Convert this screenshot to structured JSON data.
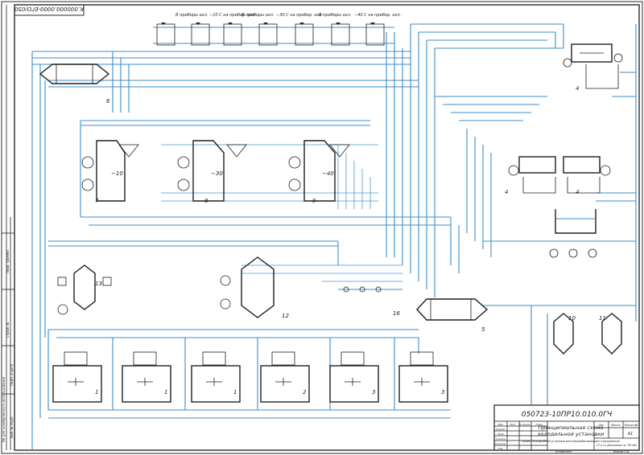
{
  "stamp_top": "К.000000.0000-ЕГО/050",
  "instrument_labels": [
    "В приборы охл.",
    "−10 С на прибор. охл.",
    "В приборы охл.",
    "−30 С на прибор. охл.",
    "В приборы охл.",
    "−40 С на прибор. охл."
  ],
  "equipment_numbers": {
    "n1a": "1",
    "n1b": "1",
    "n1c": "1",
    "n2": "2",
    "n3a": "3",
    "n3b": "3",
    "n4a": "4",
    "n4b": "4",
    "n4c": "4",
    "n5": "5",
    "n6": "6",
    "n7": "7",
    "n8": "8",
    "n9": "9",
    "n10": "10",
    "n11": "11",
    "n12": "12",
    "n13": "13",
    "n16": "16"
  },
  "temp_labels": {
    "t1": "−10",
    "t2": "−30",
    "t3": "−40"
  },
  "title_block": {
    "doc_code": "050723-10ПР10.010.0ГЧ",
    "title": "Принципиальная схема холодильной установки",
    "description": "Проект холодильной установки мясоперерабатывающего предприятия",
    "group": "СТ-н от Даниловка гр. ТМ-405",
    "sheet_format": "А1",
    "scale_label": "Масштаб",
    "sheet_label": "Лист",
    "mass_label": "Масса",
    "lit_label": "Лит.",
    "copied": "Копировал",
    "format": "Формат А1",
    "rows": [
      "Изм.",
      "Лист",
      "№ докум.",
      "Подп.",
      "Дата",
      "Разраб.",
      "Пров.",
      "Т.контр.",
      "Н.контр.",
      "Утв."
    ]
  },
  "side_stamp": "Не для коммерческого использования",
  "side_notes": [
    "Перв. примен.",
    "Справ. №",
    "Подп. и дата",
    "Инв. № дубл.",
    "Взам. инв. №",
    "Подп. и дата",
    "Инв. № подл."
  ]
}
